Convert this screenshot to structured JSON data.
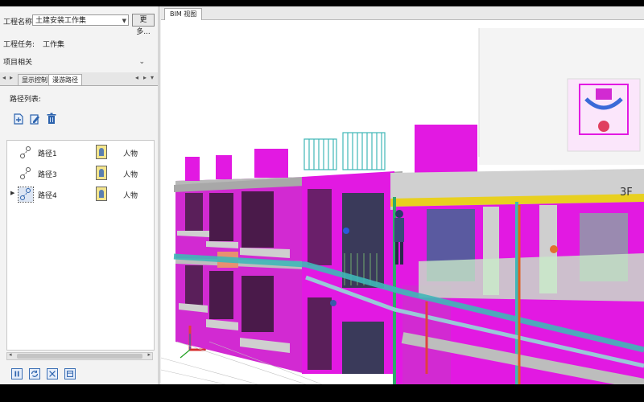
{
  "project": {
    "name_label": "工程名称:",
    "name_value": "土建安装工作集",
    "more_button": "更多...",
    "task_label": "工程任务:",
    "task_value": "工作集",
    "related_label": "项目相关"
  },
  "tabs": [
    {
      "label": "显示控制",
      "active": false
    },
    {
      "label": "漫游路径",
      "active": true
    }
  ],
  "path_panel": {
    "title": "路径列表:",
    "tools": [
      "add-path-icon",
      "edit-icon",
      "delete-icon"
    ],
    "items": [
      {
        "name": "路径1",
        "type": "人物",
        "selected": false
      },
      {
        "name": "路径3",
        "type": "人物",
        "selected": false
      },
      {
        "name": "路径4",
        "type": "人物",
        "selected": true
      }
    ],
    "bottom_tools": [
      "play-icon",
      "loop-icon",
      "expand-icon",
      "window-icon"
    ]
  },
  "viewport": {
    "tab_label": "BIM 视图",
    "floor_label": "3F"
  },
  "colors": {
    "wall_magenta": "#e219e2",
    "slab_grey": "#c8c8c8",
    "pipe_teal": "#3fb7b7",
    "pipe_yellow": "#e8d020",
    "frame_bg": "#000000"
  }
}
